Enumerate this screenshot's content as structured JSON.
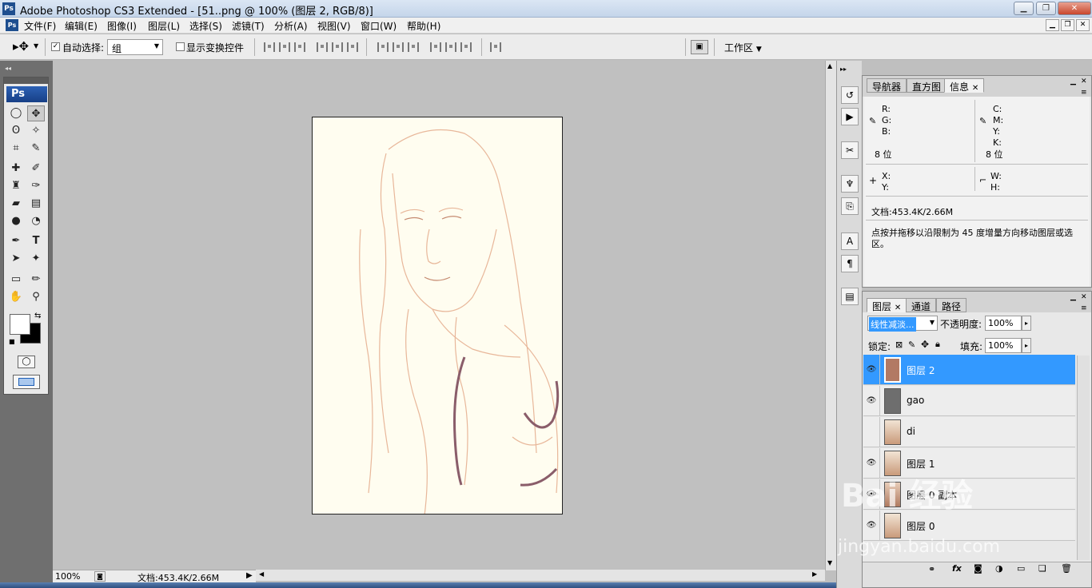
{
  "window": {
    "title": "Adobe Photoshop CS3 Extended - [51..png @ 100% (图层 2, RGB/8)]",
    "app_icon": "Ps"
  },
  "menu": [
    "文件(F)",
    "编辑(E)",
    "图像(I)",
    "图层(L)",
    "选择(S)",
    "滤镜(T)",
    "分析(A)",
    "视图(V)",
    "窗口(W)",
    "帮助(H)"
  ],
  "options_bar": {
    "auto_select_label": "自动选择:",
    "auto_select_value": "组",
    "show_transform_label": "显示变换控件",
    "workspace_label": "工作区"
  },
  "toolbox": {
    "logo": "Ps"
  },
  "status": {
    "zoom": "100%",
    "doc_info": "文档:453.4K/2.66M"
  },
  "info_panel": {
    "tabs": [
      "导航器",
      "直方图",
      "信息"
    ],
    "r_label": "R:",
    "g_label": "G:",
    "b_label": "B:",
    "c_label": "C:",
    "m_label": "M:",
    "y_label": "Y:",
    "k_label": "K:",
    "bit_left": "8 位",
    "bit_right": "8 位",
    "x_label": "X:",
    "y2_label": "Y:",
    "w_label": "W:",
    "h_label": "H:",
    "doc": "文档:453.4K/2.66M",
    "hint": "点按并拖移以沿限制为 45 度增量方向移动图层或选区。"
  },
  "layers_panel": {
    "tabs": [
      "图层",
      "通道",
      "路径"
    ],
    "blend_mode": "线性减淡...",
    "opacity_label": "不透明度:",
    "opacity": "100%",
    "lock_label": "锁定:",
    "fill_label": "填充:",
    "fill": "100%",
    "layers": [
      {
        "name": "图层 2",
        "visible": true,
        "color": "#b27a64"
      },
      {
        "name": "gao",
        "visible": true,
        "color": "#6e6e6e"
      },
      {
        "name": "di",
        "visible": false,
        "color": "#c99a7a"
      },
      {
        "name": "图层 1",
        "visible": true,
        "color": "#c99a7a"
      },
      {
        "name": "图层 0 副本",
        "visible": true,
        "color": "#b07a60"
      },
      {
        "name": "图层 0",
        "visible": true,
        "color": "#c99a7a"
      }
    ]
  },
  "watermark": {
    "text": "Bai 经验",
    "url": "jingyan.baidu.com"
  }
}
